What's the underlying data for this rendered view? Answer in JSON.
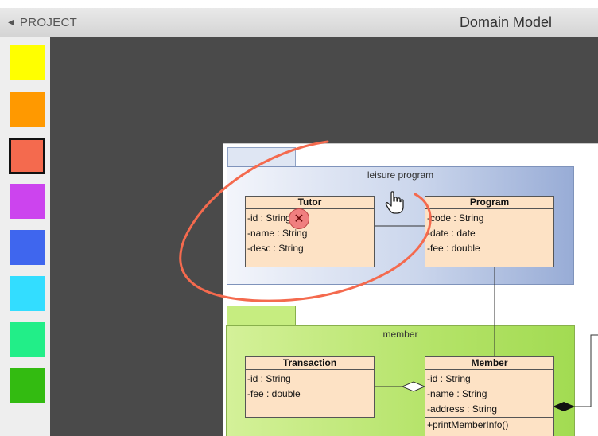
{
  "header": {
    "back_label": "PROJECT",
    "title": "Domain Model"
  },
  "palette": {
    "colors": [
      "#ffff00",
      "#ff9900",
      "#f46a4e",
      "#cc44ee",
      "#3f66ee",
      "#33ddff",
      "#22ee88",
      "#33bb11"
    ],
    "selected_index": 2
  },
  "diagram": {
    "packages": [
      {
        "name": "leisure program"
      },
      {
        "name": "member"
      }
    ],
    "classes": {
      "tutor": {
        "name": "Tutor",
        "attributes": [
          "-id : String",
          "-name : String",
          "-desc : String"
        ]
      },
      "program": {
        "name": "Program",
        "attributes": [
          "-code : String",
          "-date : date",
          "-fee : double"
        ]
      },
      "transaction": {
        "name": "Transaction",
        "attributes": [
          "-id : String",
          "-fee : double"
        ]
      },
      "member": {
        "name": "Member",
        "attributes": [
          "-id : String",
          "-name : String",
          "-address : String"
        ],
        "operations": [
          "+printMemberInfo()"
        ]
      }
    }
  },
  "icons": {
    "back": "triangle-left-icon",
    "delete": "close-circle-icon",
    "cursor": "hand-pointer-icon"
  },
  "annotation": {
    "stroke_color": "#f46a4e"
  }
}
